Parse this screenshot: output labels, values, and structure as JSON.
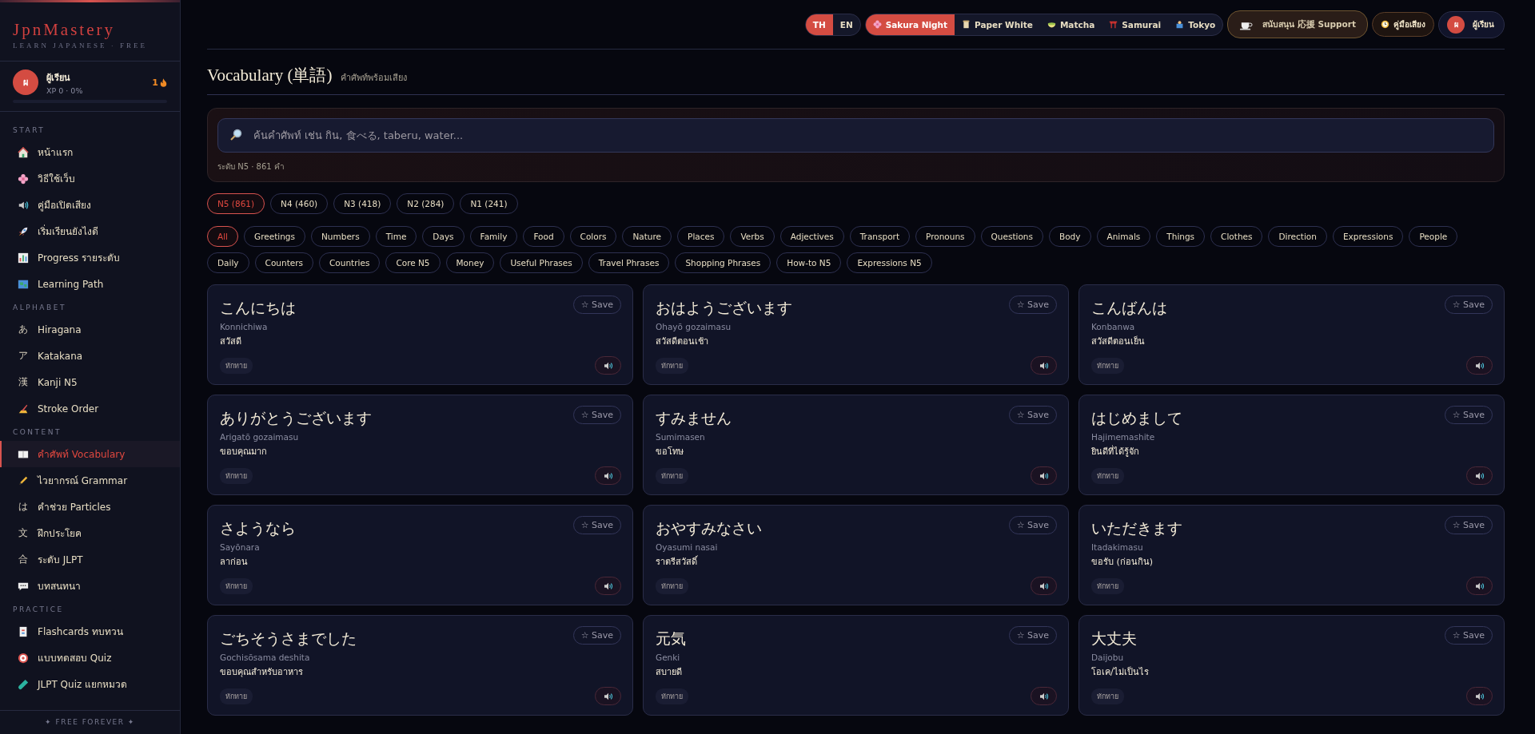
{
  "sidebar": {
    "logo": "JpnMastery",
    "tagline": "LEARN JAPANESE · FREE",
    "user": {
      "avatar": "ผ",
      "name": "ผู้เรียน",
      "xp": "XP 0 · 0%",
      "streak": "1",
      "level": 0
    },
    "sections": [
      {
        "title": "START",
        "items": [
          {
            "label": "หน้าแรก",
            "selected": false
          },
          {
            "label": "วิธีใช้เว็บ",
            "selected": false
          },
          {
            "label": "คู่มือเปิดเสียง",
            "selected": false
          },
          {
            "label": "เริ่มเรียนยังไงดี",
            "selected": false
          },
          {
            "label": "Progress รายระดับ",
            "selected": false
          },
          {
            "label": "Learning Path",
            "selected": false
          }
        ]
      },
      {
        "title": "ALPHABET",
        "items": [
          {
            "glyph": "あ",
            "label": "Hiragana",
            "selected": false
          },
          {
            "glyph": "ア",
            "label": "Katakana",
            "selected": false
          },
          {
            "glyph": "漢",
            "label": "Kanji N5",
            "selected": false
          },
          {
            "label": "Stroke Order",
            "selected": false
          }
        ]
      },
      {
        "title": "CONTENT",
        "items": [
          {
            "label": "คำศัพท์ Vocabulary",
            "selected": true
          },
          {
            "label": "ไวยากรณ์ Grammar",
            "selected": false
          },
          {
            "glyph": "は",
            "label": "คำช่วย Particles",
            "selected": false
          },
          {
            "glyph": "文",
            "label": "ฝึกประโยค",
            "selected": false
          },
          {
            "glyph": "合",
            "label": "ระดับ JLPT",
            "selected": false
          },
          {
            "label": "บทสนทนา",
            "selected": false
          }
        ]
      },
      {
        "title": "PRACTICE",
        "items": [
          {
            "label": "Flashcards ทบทวน",
            "selected": false
          },
          {
            "label": "แบบทดสอบ Quiz",
            "selected": false
          },
          {
            "label": "JLPT Quiz แยกหมวด",
            "selected": false
          }
        ]
      }
    ],
    "footer": "✦ FREE FOREVER ✦"
  },
  "topbar": {
    "languages": [
      {
        "label": "TH",
        "selected": true
      },
      {
        "label": "EN",
        "selected": false
      }
    ],
    "themes": [
      {
        "label": "Sakura Night",
        "selected": true
      },
      {
        "label": "Paper White",
        "selected": false
      },
      {
        "label": "Matcha",
        "selected": false
      },
      {
        "label": "Samurai",
        "selected": false
      },
      {
        "label": "Tokyo",
        "selected": false
      }
    ],
    "support": "สนับสนุน 応援 Support",
    "sound_guide": "คู่มือเสียง",
    "user": {
      "avatar": "ผ",
      "name": "ผู้เรียน"
    }
  },
  "header": {
    "title": "Vocabulary (単語)",
    "subtitle": "คำศัพท์พร้อมเสียง"
  },
  "search": {
    "placeholder": "ค้นคำศัพท์ เช่น กิน, 食べる, taberu, water...",
    "summary": "ระดับ N5 · 861 คำ"
  },
  "levels": [
    {
      "label": "N5 (861)",
      "selected": true
    },
    {
      "label": "N4 (460)",
      "selected": false
    },
    {
      "label": "N3 (418)",
      "selected": false
    },
    {
      "label": "N2 (284)",
      "selected": false
    },
    {
      "label": "N1 (241)",
      "selected": false
    }
  ],
  "categories": [
    {
      "label": "All",
      "selected": true
    },
    {
      "label": "Greetings",
      "selected": false
    },
    {
      "label": "Numbers",
      "selected": false
    },
    {
      "label": "Time",
      "selected": false
    },
    {
      "label": "Days",
      "selected": false
    },
    {
      "label": "Family",
      "selected": false
    },
    {
      "label": "Food",
      "selected": false
    },
    {
      "label": "Colors",
      "selected": false
    },
    {
      "label": "Nature",
      "selected": false
    },
    {
      "label": "Places",
      "selected": false
    },
    {
      "label": "Verbs",
      "selected": false
    },
    {
      "label": "Adjectives",
      "selected": false
    },
    {
      "label": "Transport",
      "selected": false
    },
    {
      "label": "Pronouns",
      "selected": false
    },
    {
      "label": "Questions",
      "selected": false
    },
    {
      "label": "Body",
      "selected": false
    },
    {
      "label": "Animals",
      "selected": false
    },
    {
      "label": "Things",
      "selected": false
    },
    {
      "label": "Clothes",
      "selected": false
    },
    {
      "label": "Direction",
      "selected": false
    },
    {
      "label": "Expressions",
      "selected": false
    },
    {
      "label": "People",
      "selected": false
    },
    {
      "label": "Daily",
      "selected": false
    },
    {
      "label": "Counters",
      "selected": false
    },
    {
      "label": "Countries",
      "selected": false
    },
    {
      "label": "Core N5",
      "selected": false
    },
    {
      "label": "Money",
      "selected": false
    },
    {
      "label": "Useful Phrases",
      "selected": false
    },
    {
      "label": "Travel Phrases",
      "selected": false
    },
    {
      "label": "Shopping Phrases",
      "selected": false
    },
    {
      "label": "How-to N5",
      "selected": false
    },
    {
      "label": "Expressions N5",
      "selected": false
    }
  ],
  "cards": [
    {
      "japanese": "こんにちは",
      "romaji": "Konnichiwa",
      "thai": "สวัสดี",
      "tag": "ทักทาย",
      "save": "☆ Save"
    },
    {
      "japanese": "おはようございます",
      "romaji": "Ohayō gozaimasu",
      "thai": "สวัสดีตอนเช้า",
      "tag": "ทักทาย",
      "save": "☆ Save"
    },
    {
      "japanese": "こんばんは",
      "romaji": "Konbanwa",
      "thai": "สวัสดีตอนเย็น",
      "tag": "ทักทาย",
      "save": "☆ Save"
    },
    {
      "japanese": "ありがとうございます",
      "romaji": "Arigatō gozaimasu",
      "thai": "ขอบคุณมาก",
      "tag": "ทักทาย",
      "save": "☆ Save"
    },
    {
      "japanese": "すみません",
      "romaji": "Sumimasen",
      "thai": "ขอโทษ",
      "tag": "ทักทาย",
      "save": "☆ Save"
    },
    {
      "japanese": "はじめまして",
      "romaji": "Hajimemashite",
      "thai": "ยินดีที่ได้รู้จัก",
      "tag": "ทักทาย",
      "save": "☆ Save"
    },
    {
      "japanese": "さようなら",
      "romaji": "Sayōnara",
      "thai": "ลาก่อน",
      "tag": "ทักทาย",
      "save": "☆ Save"
    },
    {
      "japanese": "おやすみなさい",
      "romaji": "Oyasumi nasai",
      "thai": "ราตรีสวัสดิ์",
      "tag": "ทักทาย",
      "save": "☆ Save"
    },
    {
      "japanese": "いただきます",
      "romaji": "Itadakimasu",
      "thai": "ขอรับ (ก่อนกิน)",
      "tag": "ทักทาย",
      "save": "☆ Save"
    },
    {
      "japanese": "ごちそうさまでした",
      "romaji": "Gochisōsama deshita",
      "thai": "ขอบคุณสำหรับอาหาร",
      "tag": "ทักทาย",
      "save": "☆ Save"
    },
    {
      "japanese": "元気",
      "romaji": "Genki",
      "thai": "สบายดี",
      "tag": "ทักทาย",
      "save": "☆ Save"
    },
    {
      "japanese": "大丈夫",
      "romaji": "Daijobu",
      "thai": "โอเค/ไม่เป็นไร",
      "tag": "ทักทาย",
      "save": "☆ Save"
    }
  ]
}
